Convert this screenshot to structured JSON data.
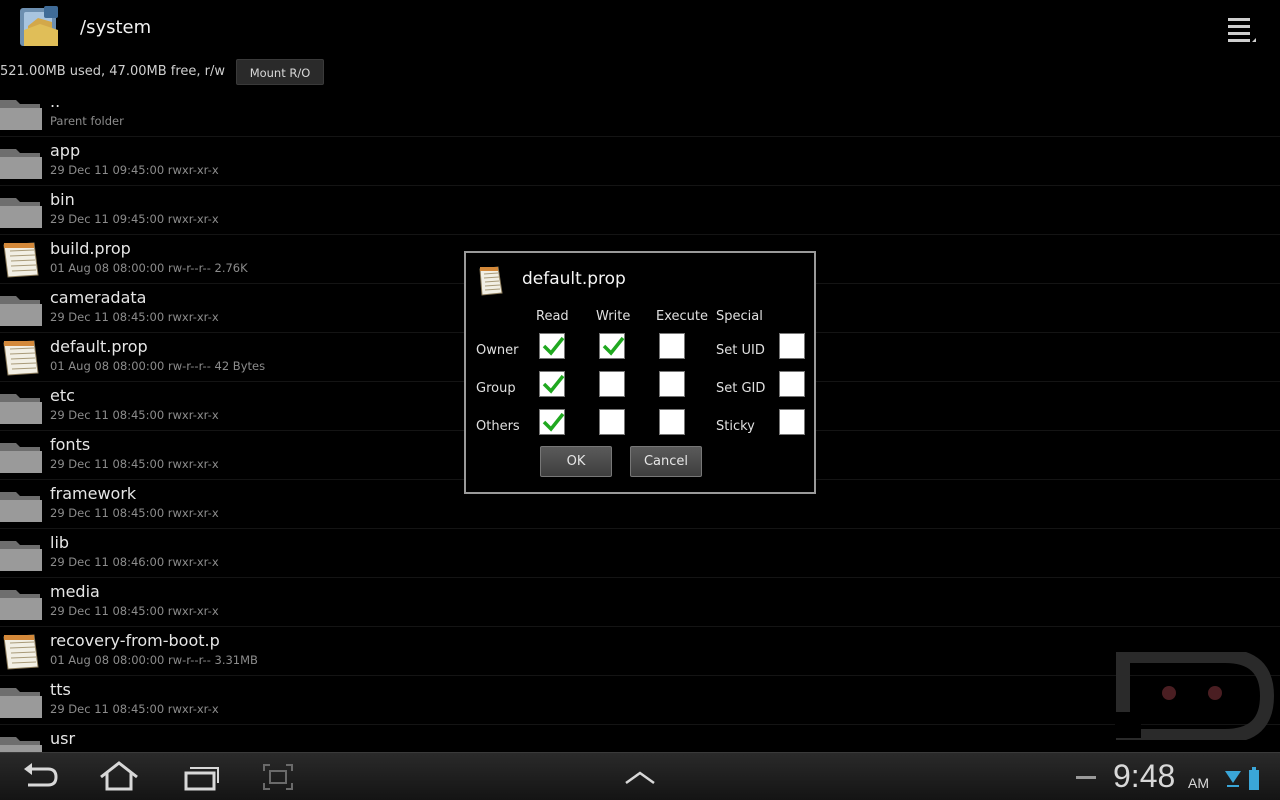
{
  "header": {
    "path": "/system",
    "app_icon": "folder-app-icon",
    "menu_icon": "overflow-menu-icon"
  },
  "storage": {
    "info": "521.00MB used, 47.00MB free, r/w",
    "mount_label": "Mount R/O"
  },
  "files": [
    {
      "name": "..",
      "meta": "Parent folder",
      "icon": "folder-icon"
    },
    {
      "name": "app",
      "meta": "29 Dec 11 09:45:00  rwxr-xr-x",
      "icon": "folder-icon"
    },
    {
      "name": "bin",
      "meta": "29 Dec 11 09:45:00  rwxr-xr-x",
      "icon": "folder-icon"
    },
    {
      "name": "build.prop",
      "meta": "01 Aug 08 08:00:00  rw-r--r--  2.76K",
      "icon": "document-icon"
    },
    {
      "name": "cameradata",
      "meta": "29 Dec 11 08:45:00  rwxr-xr-x",
      "icon": "folder-icon"
    },
    {
      "name": "default.prop",
      "meta": "01 Aug 08 08:00:00  rw-r--r--  42 Bytes",
      "icon": "document-icon"
    },
    {
      "name": "etc",
      "meta": "29 Dec 11 08:45:00  rwxr-xr-x",
      "icon": "folder-icon"
    },
    {
      "name": "fonts",
      "meta": "29 Dec 11 08:45:00  rwxr-xr-x",
      "icon": "folder-icon"
    },
    {
      "name": "framework",
      "meta": "29 Dec 11 08:45:00  rwxr-xr-x",
      "icon": "folder-icon"
    },
    {
      "name": "lib",
      "meta": "29 Dec 11 08:46:00  rwxr-xr-x",
      "icon": "folder-icon"
    },
    {
      "name": "media",
      "meta": "29 Dec 11 08:45:00  rwxr-xr-x",
      "icon": "folder-icon"
    },
    {
      "name": "recovery-from-boot.p",
      "meta": "01 Aug 08 08:00:00  rw-r--r--  3.31MB",
      "icon": "document-icon"
    },
    {
      "name": "tts",
      "meta": "29 Dec 11 08:45:00  rwxr-xr-x",
      "icon": "folder-icon"
    },
    {
      "name": "usr",
      "meta": "",
      "icon": "folder-icon"
    }
  ],
  "dialog": {
    "title": "default.prop",
    "icon": "document-icon",
    "columns": {
      "read": "Read",
      "write": "Write",
      "execute": "Execute",
      "special": "Special"
    },
    "rows": [
      {
        "label": "Owner",
        "read": true,
        "write": true,
        "execute": false,
        "special_label": "Set UID",
        "special": false
      },
      {
        "label": "Group",
        "read": true,
        "write": false,
        "execute": false,
        "special_label": "Set GID",
        "special": false
      },
      {
        "label": "Others",
        "read": true,
        "write": false,
        "execute": false,
        "special_label": "Sticky",
        "special": false
      }
    ],
    "ok_label": "OK",
    "cancel_label": "Cancel",
    "check_color": "#1fa81f"
  },
  "system_bar": {
    "time": "9:48",
    "ampm": "AM",
    "nav_icons": [
      "back-icon",
      "home-icon",
      "recent-apps-icon",
      "screenshot-icon"
    ],
    "status_icons": [
      "wifi-icon",
      "battery-icon"
    ]
  }
}
